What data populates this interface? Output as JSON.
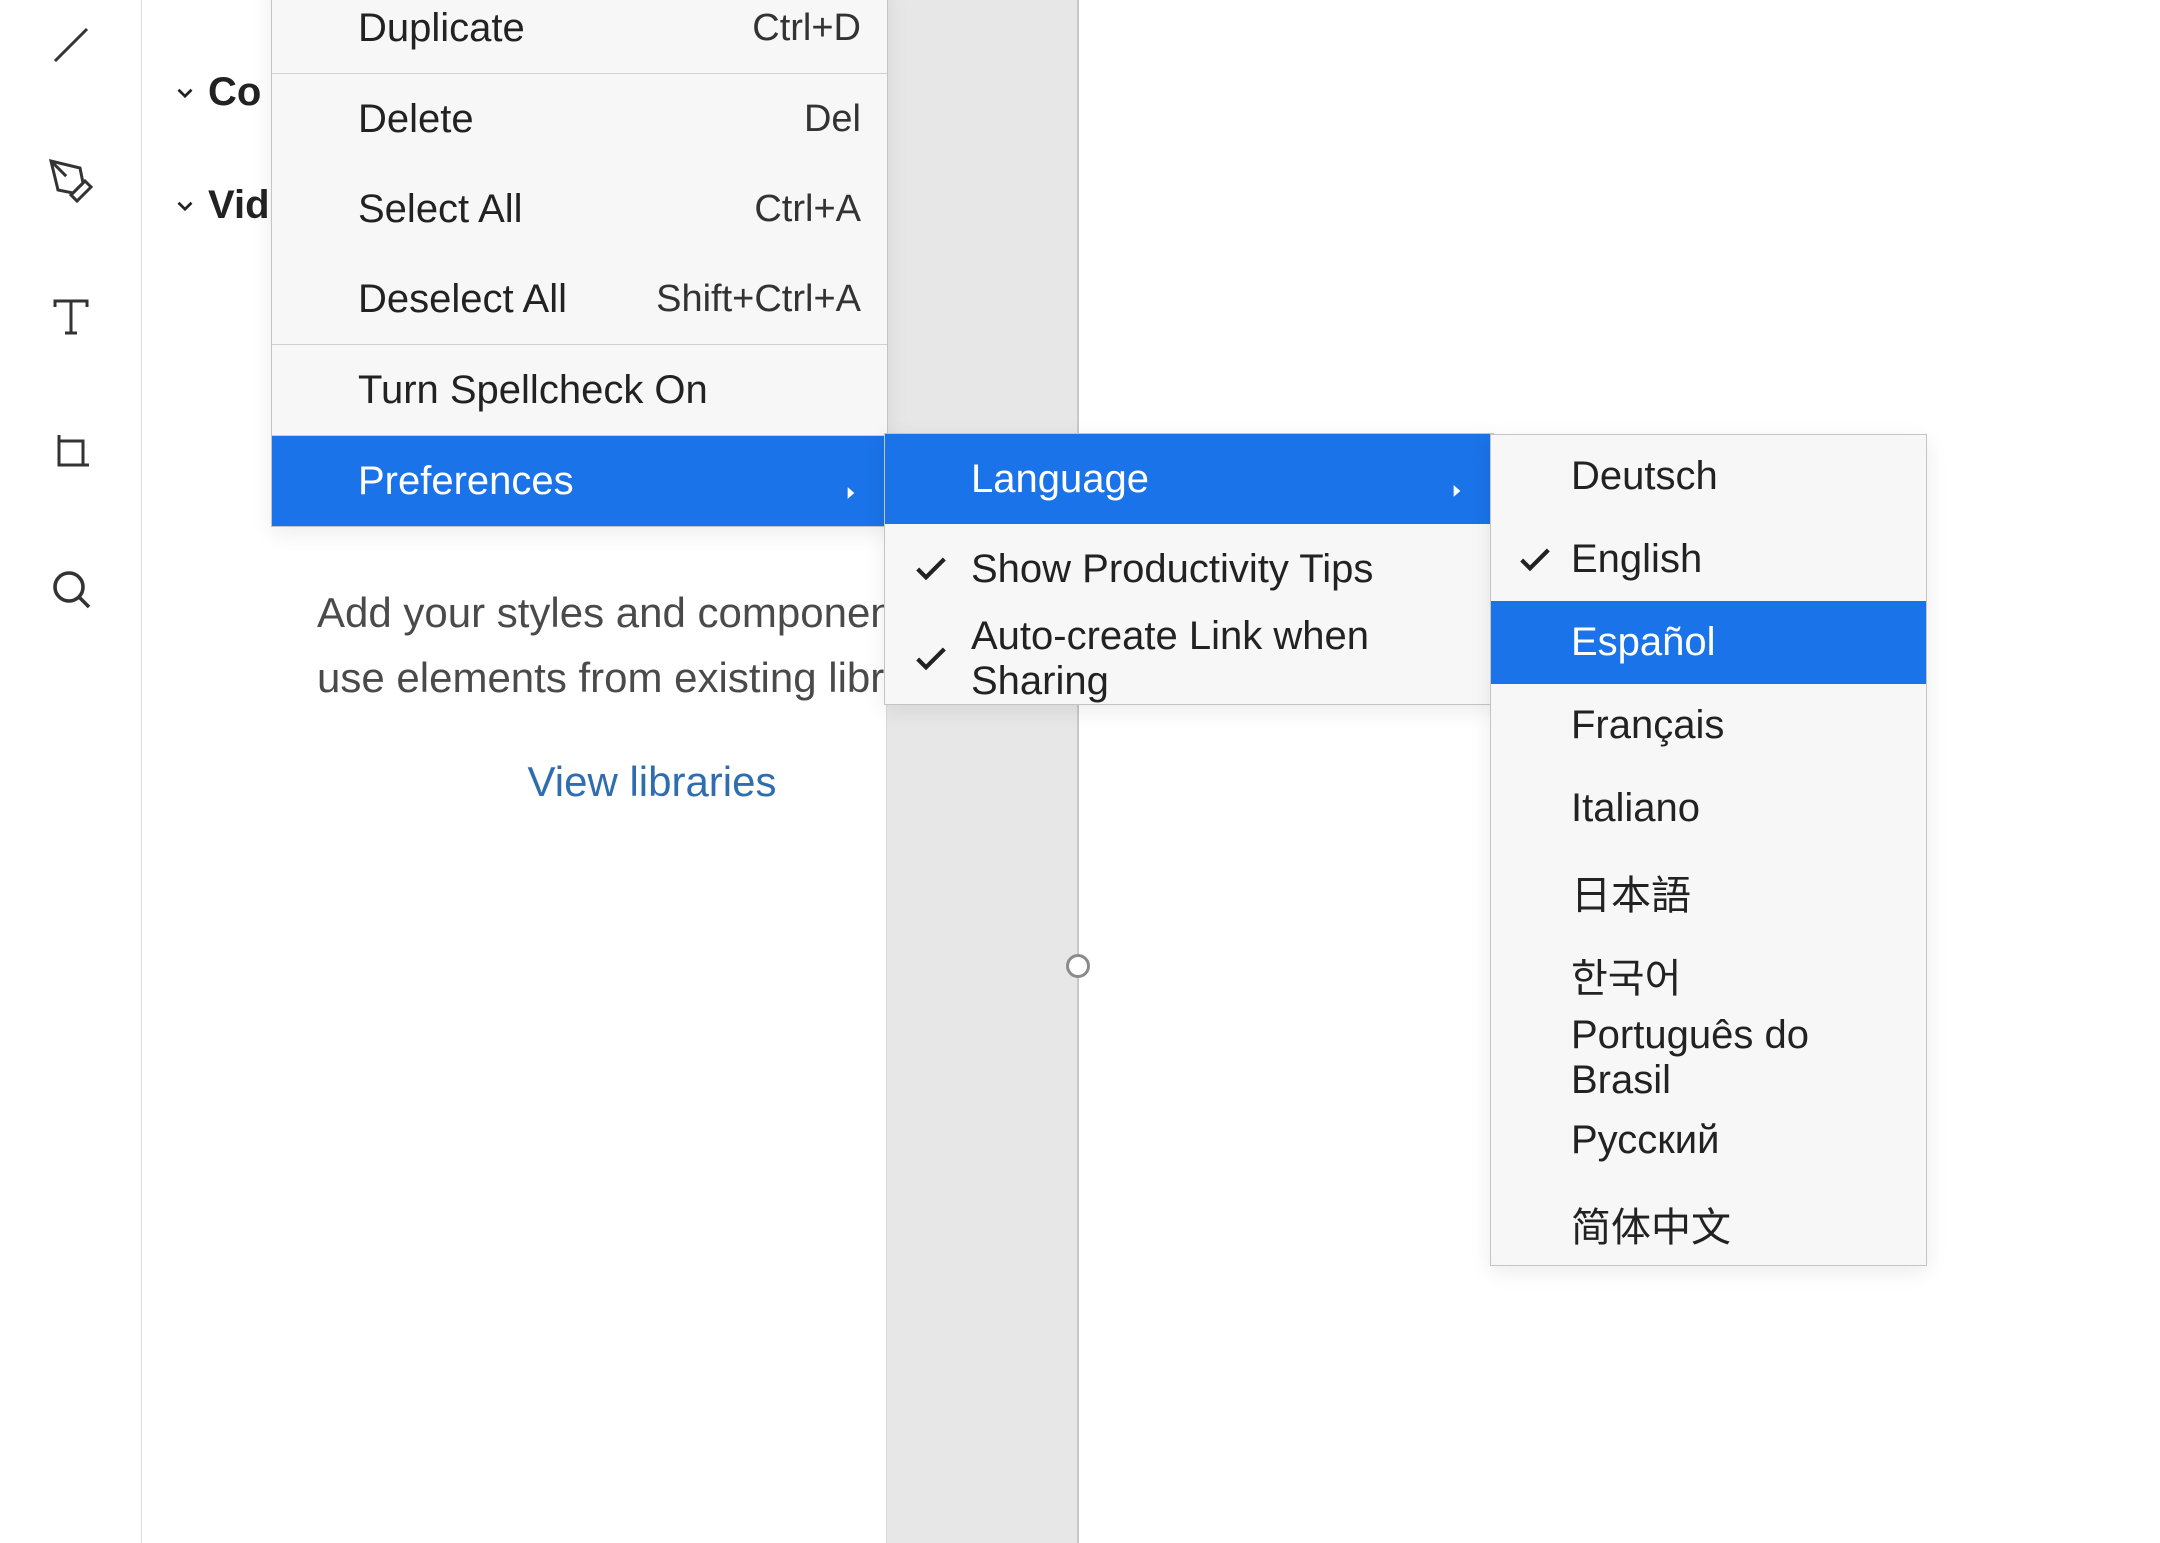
{
  "toolbar": {
    "tools": [
      "line",
      "pen",
      "text",
      "artboard",
      "search"
    ]
  },
  "sidebar": {
    "sections": [
      {
        "label": "Co"
      },
      {
        "label": "Vid"
      }
    ],
    "hint_text": "Add your styles and components, or use elements from existing libraries.",
    "link_text": "View libraries"
  },
  "menu_main": {
    "items": [
      {
        "label": "Duplicate",
        "shortcut": "Ctrl+D",
        "sep_after": true
      },
      {
        "label": "Delete",
        "shortcut": "Del"
      },
      {
        "label": "Select All",
        "shortcut": "Ctrl+A"
      },
      {
        "label": "Deselect All",
        "shortcut": "Shift+Ctrl+A",
        "sep_after": true
      },
      {
        "label": "Turn Spellcheck On",
        "sep_after": true
      },
      {
        "label": "Preferences",
        "has_submenu": true,
        "highlighted": true
      }
    ]
  },
  "menu_prefs": {
    "items": [
      {
        "label": "Language",
        "has_submenu": true,
        "highlighted": true
      },
      {
        "label": "Show Productivity Tips",
        "checked": true
      },
      {
        "label": "Auto-create Link when Sharing",
        "checked": true
      }
    ]
  },
  "menu_lang": {
    "items": [
      {
        "label": "Deutsch"
      },
      {
        "label": "English",
        "checked": true
      },
      {
        "label": "Español",
        "highlighted": true
      },
      {
        "label": "Français"
      },
      {
        "label": "Italiano"
      },
      {
        "label": "日本語"
      },
      {
        "label": "한국어"
      },
      {
        "label": "Português do Brasil"
      },
      {
        "label": "Русский"
      },
      {
        "label": "简体中文"
      }
    ]
  },
  "colors": {
    "highlight": "#1a73e8"
  }
}
